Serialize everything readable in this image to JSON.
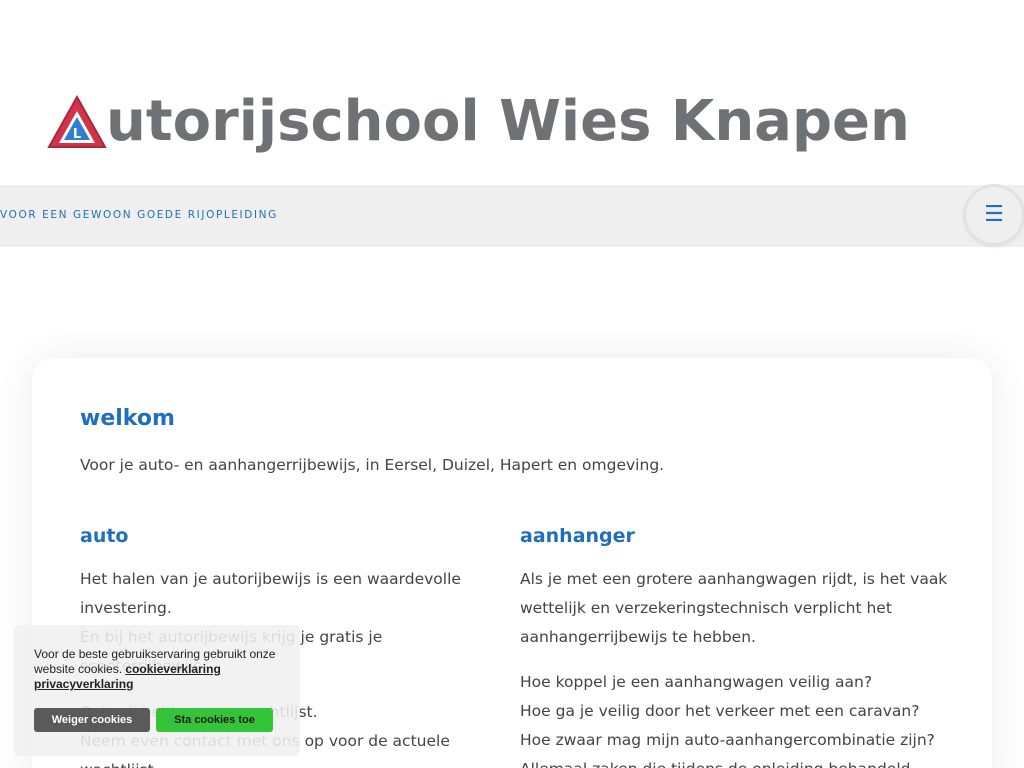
{
  "header": {
    "logo_text": "utorijschool Wies Knapen",
    "logo_badge_letter": "L"
  },
  "navbar": {
    "tagline": "VOOR EEN GEWOON GOEDE RIJOPLEIDING",
    "menu_icon": "hamburger-icon"
  },
  "content": {
    "welcome_title": "welkom",
    "intro": "Voor je auto- en aanhangerrijbewijs, in Eersel, Duizel, Hapert en omgeving.",
    "auto": {
      "title": "auto",
      "p1": "Het halen van je autorijbewijs is een waardevolle investering.",
      "p2": "En bij het autorijbewijs krijg je gratis je scooterrijbewijs.",
      "p3": "Ook wij hebben een wachtlijst.",
      "p4": "Neem even contact met ons op voor de actuele wachtlijst."
    },
    "aanhanger": {
      "title": "aanhanger",
      "p1": "Als je met een grotere aanhangwagen rijdt, is het vaak wettelijk en verzekeringstechnisch verplicht het aanhangerrijbewijs te hebben.",
      "q1": "Hoe koppel je een aanhangwagen veilig aan?",
      "q2": "Hoe ga je veilig door het verkeer met een caravan?",
      "q3": "Hoe zwaar mag mijn auto-aanhangercombinatie zijn?",
      "q4": "Allemaal zaken die tijdens de opleiding behandeld"
    }
  },
  "cookie": {
    "text": "Voor de beste gebruikservaring gebruikt onze website cookies.",
    "link1": "cookieverklaring",
    "link2": "privacyverklaring",
    "deny_label": "Weiger cookies",
    "accept_label": "Sta cookies toe"
  },
  "colors": {
    "accent": "#1f6fbf",
    "logo_gray": "#6f7275",
    "logo_red": "#d0334a",
    "accept_green": "#34c43a"
  }
}
